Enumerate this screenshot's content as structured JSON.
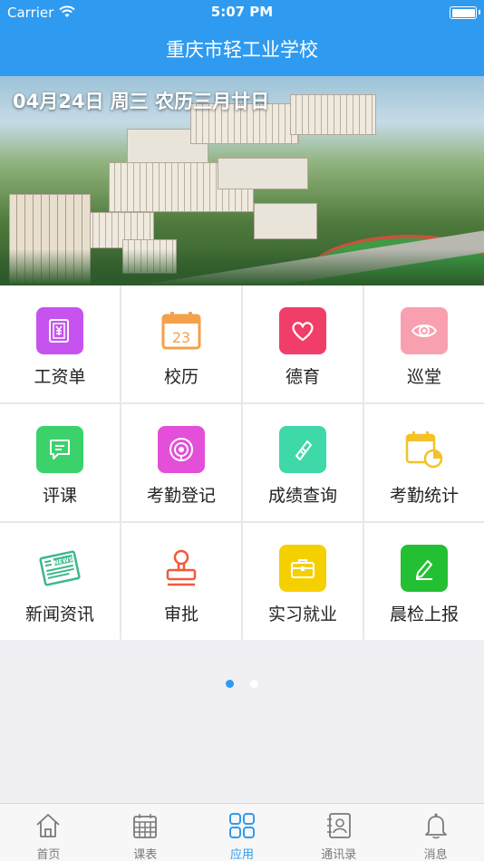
{
  "status": {
    "carrier": "Carrier",
    "time": "5:07 PM"
  },
  "nav": {
    "title": "重庆市轻工业学校"
  },
  "banner": {
    "date": "04月24日 周三 农历三月廿日"
  },
  "apps": [
    {
      "label": "工资单",
      "icon": "payslip-icon",
      "color": "#c653f0"
    },
    {
      "label": "校历",
      "icon": "calendar-icon",
      "color": "#f5a04a",
      "icon_text": "23"
    },
    {
      "label": "德育",
      "icon": "heart-icon",
      "color": "#f03e68"
    },
    {
      "label": "巡堂",
      "icon": "eye-icon",
      "color": "#f8a0b0"
    },
    {
      "label": "评课",
      "icon": "comment-icon",
      "color": "#3bd26b"
    },
    {
      "label": "考勤登记",
      "icon": "attendance-icon",
      "color": "#e34fd9"
    },
    {
      "label": "成绩查询",
      "icon": "grade-icon",
      "color": "#3fd8a8"
    },
    {
      "label": "考勤统计",
      "icon": "attendance-stats-icon",
      "color": "#f2c22a"
    },
    {
      "label": "新闻资讯",
      "icon": "news-icon",
      "color": "#3db88a",
      "icon_text": "NEWS"
    },
    {
      "label": "审批",
      "icon": "stamp-icon",
      "color": "#f05a3c"
    },
    {
      "label": "实习就业",
      "icon": "briefcase-icon",
      "color": "#f5d000"
    },
    {
      "label": "晨检上报",
      "icon": "edit-icon",
      "color": "#24c034"
    }
  ],
  "pager": {
    "count": 2,
    "active": 0
  },
  "tabs": [
    {
      "label": "首页",
      "icon": "home-icon"
    },
    {
      "label": "课表",
      "icon": "schedule-icon"
    },
    {
      "label": "应用",
      "icon": "apps-icon",
      "active": true
    },
    {
      "label": "通讯录",
      "icon": "contacts-icon"
    },
    {
      "label": "消息",
      "icon": "bell-icon"
    }
  ],
  "colors": {
    "primary": "#2f9bf0",
    "tab_inactive": "#7a7a7a"
  }
}
